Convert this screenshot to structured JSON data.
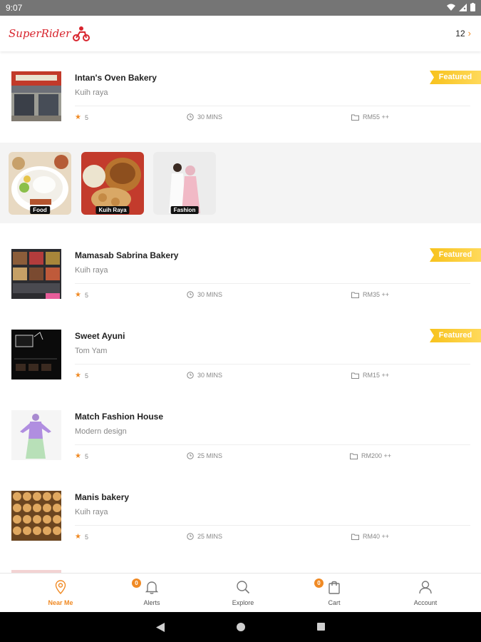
{
  "status_bar": {
    "time": "9:07"
  },
  "app_bar": {
    "logo_text": "SuperRider",
    "count": "12",
    "chevron": "›"
  },
  "items": [
    {
      "name": "Intan's Oven Bakery",
      "desc": "Kuih raya",
      "rating": "5",
      "time": "30 MINS",
      "price": "RM55 ++",
      "featured": "Featured"
    },
    {
      "name": "Mamasab Sabrina Bakery",
      "desc": "Kuih raya",
      "rating": "5",
      "time": "30 MINS",
      "price": "RM35 ++",
      "featured": "Featured"
    },
    {
      "name": "Sweet Ayuni",
      "desc": "Tom Yam",
      "rating": "5",
      "time": "30 MINS",
      "price": "RM15 ++",
      "featured": "Featured"
    },
    {
      "name": "Match Fashion House",
      "desc": "Modern design",
      "rating": "5",
      "time": "25 MINS",
      "price": "RM200 ++"
    },
    {
      "name": "Manis bakery",
      "desc": "Kuih raya",
      "rating": "5",
      "time": "25 MINS",
      "price": "RM40 ++"
    }
  ],
  "categories": [
    {
      "label": "Food"
    },
    {
      "label": "Kuih Raya"
    },
    {
      "label": "Fashion"
    }
  ],
  "bottom_nav": [
    {
      "label": "Near Me",
      "icon": "location-pin-icon"
    },
    {
      "label": "Alerts",
      "icon": "bell-icon",
      "badge": "0"
    },
    {
      "label": "Explore",
      "icon": "search-icon"
    },
    {
      "label": "Cart",
      "icon": "cart-icon",
      "badge": "0"
    },
    {
      "label": "Account",
      "icon": "person-icon"
    }
  ],
  "colors": {
    "accent": "#f08a24",
    "featured": "#f7c21c",
    "logo": "#d8252e"
  }
}
